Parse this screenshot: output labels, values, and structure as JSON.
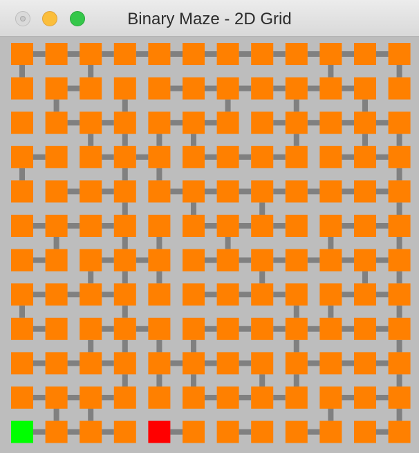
{
  "window": {
    "title": "Binary Maze - 2D Grid",
    "buttons": [
      "close",
      "minimize",
      "zoom"
    ]
  },
  "maze": {
    "rows": 12,
    "cols": 12,
    "colors": {
      "background": "#bdbdbd",
      "cell": "#ff8000",
      "passage": "#808080",
      "start": "#00ff00",
      "goal": "#ff0000"
    },
    "start": [
      11,
      0
    ],
    "goal": [
      11,
      4
    ],
    "horizontal_passages": [
      [
        1,
        1,
        1,
        1,
        1,
        1,
        1,
        1,
        1,
        1,
        1
      ],
      [
        0,
        1,
        0,
        0,
        1,
        1,
        1,
        1,
        1,
        1,
        0
      ],
      [
        0,
        1,
        1,
        0,
        1,
        1,
        0,
        1,
        1,
        1,
        1
      ],
      [
        1,
        0,
        1,
        1,
        0,
        1,
        1,
        1,
        0,
        1,
        1
      ],
      [
        0,
        1,
        1,
        0,
        1,
        1,
        1,
        1,
        1,
        1,
        1
      ],
      [
        1,
        1,
        1,
        0,
        0,
        1,
        1,
        1,
        0,
        1,
        1
      ],
      [
        1,
        0,
        1,
        1,
        0,
        1,
        1,
        1,
        1,
        1,
        1
      ],
      [
        1,
        1,
        1,
        0,
        0,
        1,
        1,
        1,
        0,
        1,
        1
      ],
      [
        1,
        0,
        1,
        1,
        0,
        1,
        1,
        1,
        1,
        1,
        1
      ],
      [
        1,
        1,
        1,
        0,
        1,
        1,
        1,
        0,
        1,
        1,
        1
      ],
      [
        1,
        1,
        1,
        0,
        0,
        1,
        1,
        1,
        0,
        1,
        1
      ],
      [
        1,
        1,
        1,
        0,
        1,
        0,
        1,
        0,
        1,
        0,
        1
      ]
    ],
    "vertical_passages": [
      [
        1,
        0,
        1,
        0,
        0,
        0,
        0,
        0,
        0,
        1,
        0,
        1
      ],
      [
        0,
        1,
        0,
        1,
        0,
        0,
        1,
        0,
        1,
        0,
        1,
        0
      ],
      [
        0,
        0,
        1,
        1,
        1,
        1,
        0,
        0,
        1,
        0,
        1,
        1
      ],
      [
        1,
        0,
        0,
        1,
        1,
        0,
        0,
        0,
        0,
        0,
        0,
        1
      ],
      [
        0,
        0,
        0,
        1,
        0,
        1,
        0,
        1,
        0,
        0,
        0,
        1
      ],
      [
        0,
        1,
        0,
        1,
        1,
        0,
        1,
        0,
        0,
        1,
        0,
        1
      ],
      [
        0,
        0,
        1,
        1,
        1,
        0,
        0,
        1,
        0,
        0,
        1,
        1
      ],
      [
        1,
        0,
        0,
        1,
        0,
        0,
        0,
        0,
        1,
        1,
        0,
        1
      ],
      [
        0,
        0,
        1,
        1,
        1,
        1,
        0,
        0,
        1,
        0,
        0,
        1
      ],
      [
        0,
        0,
        0,
        1,
        1,
        1,
        0,
        1,
        1,
        0,
        0,
        1
      ],
      [
        0,
        1,
        1,
        0,
        0,
        0,
        0,
        0,
        0,
        1,
        0,
        1
      ]
    ]
  }
}
